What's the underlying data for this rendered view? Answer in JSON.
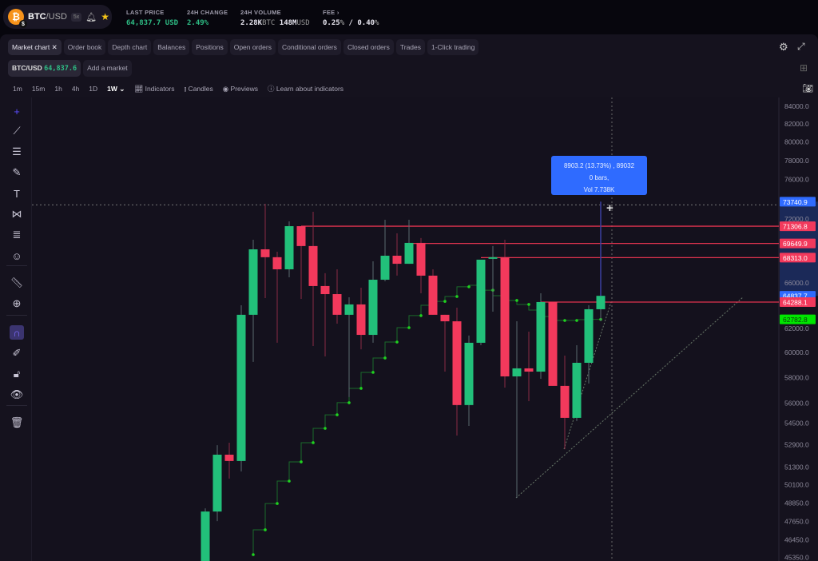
{
  "header": {
    "pair_base": "BTC",
    "pair_quote": "/USD",
    "leverage": "5x",
    "logo_glyph": "₿",
    "logo_sub": "$",
    "stats": [
      {
        "label": "LAST PRICE",
        "value": "64,837.7",
        "unit": "USD"
      },
      {
        "label": "24H CHANGE",
        "value": "2.49",
        "unit": "%"
      },
      {
        "label": "24H VOLUME",
        "value": "2.28K",
        "unit": "BTC",
        "value2": "148M",
        "unit2": "USD"
      },
      {
        "label": "FEE",
        "value": "0.25",
        "unit": "%",
        "value2": "/ 0.40",
        "unit2": "%"
      }
    ]
  },
  "tabs": [
    "Market chart",
    "Order book",
    "Depth chart",
    "Balances",
    "Positions",
    "Open orders",
    "Conditional orders",
    "Closed orders",
    "Trades",
    "1-Click trading"
  ],
  "market": {
    "pair": "BTC/USD",
    "price": "64,837.6",
    "add": "Add a market"
  },
  "toolbar": {
    "intervals": [
      "1m",
      "15m",
      "1h",
      "4h",
      "1D",
      "1W"
    ],
    "selected": "1W",
    "indicators": "Indicators",
    "candles": "Candles",
    "previews": "Previews",
    "learn": "Learn about indicators"
  },
  "tooltip": {
    "line1": "8903.2 (13.73%) , 89032",
    "line2": "0 bars,",
    "line3": "Vol 7.738K"
  },
  "colors": {
    "up": "#22c07a",
    "down": "#f2395c",
    "accent": "#2f6bff",
    "supertrend": "#1fd11f"
  },
  "chart_data": {
    "type": "candlestick",
    "scale": "log",
    "ylim": [
      45350,
      84000
    ],
    "timeframe": "1W",
    "yticks": [
      "84000.0",
      "82000.0",
      "80000.0",
      "78000.0",
      "76000.0",
      "72000.0",
      "66000.0",
      "62000.0",
      "60000.0",
      "58000.0",
      "56000.0",
      "54500.0",
      "52900.0",
      "51300.0",
      "50100.0",
      "48850.0",
      "47650.0",
      "46450.0",
      "45350.0"
    ],
    "candles": [
      [
        44500,
        48500,
        44000,
        48290
      ],
      [
        48290,
        52870,
        47660,
        52190
      ],
      [
        52190,
        53050,
        50510,
        51740
      ],
      [
        51740,
        64010,
        51010,
        63180
      ],
      [
        63180,
        70000,
        59240,
        69090
      ],
      [
        69090,
        73530,
        64640,
        68350
      ],
      [
        68350,
        68860,
        60810,
        67230
      ],
      [
        67230,
        71780,
        66500,
        71310
      ],
      [
        71310,
        71310,
        64570,
        69400
      ],
      [
        69400,
        72730,
        60540,
        65710
      ],
      [
        65710,
        66870,
        59690,
        64990
      ],
      [
        64990,
        67230,
        62420,
        63180
      ],
      [
        63180,
        64710,
        56460,
        64080
      ],
      [
        64080,
        65560,
        60270,
        61470
      ],
      [
        61470,
        67970,
        60810,
        66280
      ],
      [
        66280,
        71940,
        66140,
        68490
      ],
      [
        68490,
        70610,
        66650,
        67740
      ],
      [
        67740,
        71940,
        67740,
        69700
      ],
      [
        69700,
        70160,
        65060,
        66650
      ],
      [
        66650,
        67230,
        63180,
        63180
      ],
      [
        63180,
        63180,
        58460,
        62620
      ],
      [
        62620,
        63800,
        53570,
        55850
      ],
      [
        55850,
        61410,
        54280,
        60810
      ],
      [
        60810,
        68120,
        60610,
        68120
      ],
      [
        68270,
        69400,
        63450,
        68350
      ],
      [
        68350,
        70000,
        57200,
        58080
      ],
      [
        58080,
        62620,
        49200,
        58720
      ],
      [
        58720,
        61740,
        56150,
        58460
      ],
      [
        58460,
        65060,
        57890,
        64290
      ],
      [
        64290,
        64290,
        57330,
        57330
      ],
      [
        57330,
        59750,
        52580,
        54880
      ],
      [
        54880,
        60610,
        54640,
        59170
      ],
      [
        59170,
        64010,
        57520,
        63660
      ],
      [
        63660,
        65000,
        62620,
        64837.7
      ]
    ],
    "supertrend_start_index": 4,
    "supertrend": [
      45530,
      47100,
      48820,
      50340,
      51680,
      53050,
      54100,
      55110,
      56030,
      57140,
      58400,
      59560,
      60870,
      62080,
      63110,
      64010,
      64350,
      64780,
      65640,
      65780,
      65340,
      64850,
      64430,
      64080,
      63590,
      63030,
      62690,
      62690,
      62760,
      62782.8
    ],
    "levels": [
      {
        "value": 71306.8,
        "label": "71306.8",
        "from_index": 8
      },
      {
        "value": 69649.9,
        "label": "69649.9",
        "from_index": 17
      },
      {
        "value": 68313.0,
        "label": "68313.0",
        "from_index": 23
      },
      {
        "value": 64288.1,
        "label": "64288.1",
        "from_index": 28
      }
    ],
    "price_labels": [
      {
        "text": "73740.9",
        "value": 73740.9,
        "color": "#2f6bff"
      },
      {
        "text": "71306.8",
        "value": 71306.8,
        "color": "#f2395c"
      },
      {
        "text": "69649.9",
        "value": 69649.9,
        "color": "#f2395c"
      },
      {
        "text": "68313.0",
        "value": 68313.0,
        "color": "#f2395c"
      },
      {
        "text": "64837.7",
        "value": 64837.7,
        "color": "#2f6bff"
      },
      {
        "text": "64288.1",
        "value": 64288.1,
        "color": "#f2395c"
      },
      {
        "text": "62782.8",
        "value": 62782.8,
        "color": "#00e600"
      }
    ],
    "measure": {
      "from": 64837.7,
      "to": 73740.9
    }
  }
}
